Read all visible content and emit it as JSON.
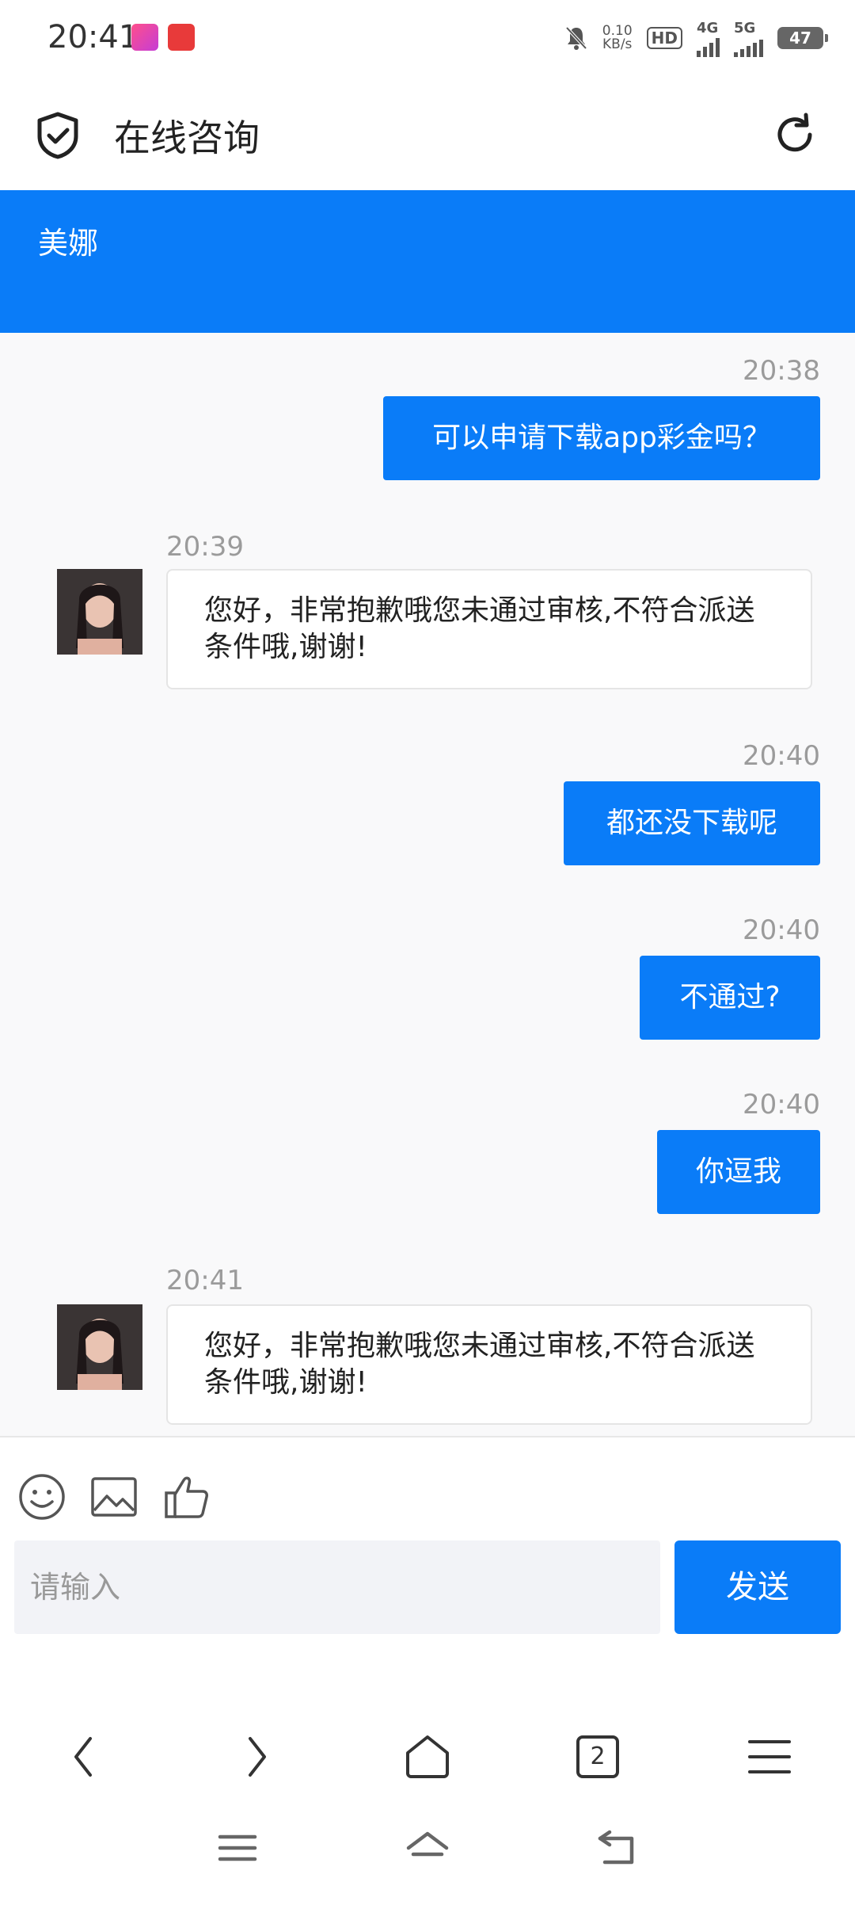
{
  "status_bar": {
    "time": "20:41",
    "net_speed_value": "0.10",
    "net_speed_unit": "KB/s",
    "hd_label": "HD",
    "net_4g": "4G",
    "net_5g": "5G",
    "battery": "47"
  },
  "header": {
    "title": "在线咨询"
  },
  "banner": {
    "agent_name": "美娜"
  },
  "messages": [
    {
      "side": "out",
      "time": "20:38",
      "text": "可以申请下载app彩金吗？"
    },
    {
      "side": "in",
      "time": "20:39",
      "text": "您好，非常抱歉哦您未通过审核,不符合派送条件哦,谢谢!"
    },
    {
      "side": "out",
      "time": "20:40",
      "text": "都还没下载呢"
    },
    {
      "side": "out",
      "time": "20:40",
      "text": "不通过?"
    },
    {
      "side": "out",
      "time": "20:40",
      "text": "你逗我"
    },
    {
      "side": "in",
      "time": "20:41",
      "text": "您好，非常抱歉哦您未通过审核,不符合派送条件哦,谢谢!"
    }
  ],
  "composer": {
    "placeholder": "请输入",
    "send_label": "发送"
  },
  "browser": {
    "tab_count": "2"
  },
  "icons": {
    "shield": "shield-check-icon",
    "refresh": "refresh-icon",
    "emoji": "smiley-icon",
    "image": "image-icon",
    "like": "thumbs-up-icon"
  },
  "colors": {
    "accent": "#0a7cf8",
    "chat_bg": "#f9f9fa"
  }
}
